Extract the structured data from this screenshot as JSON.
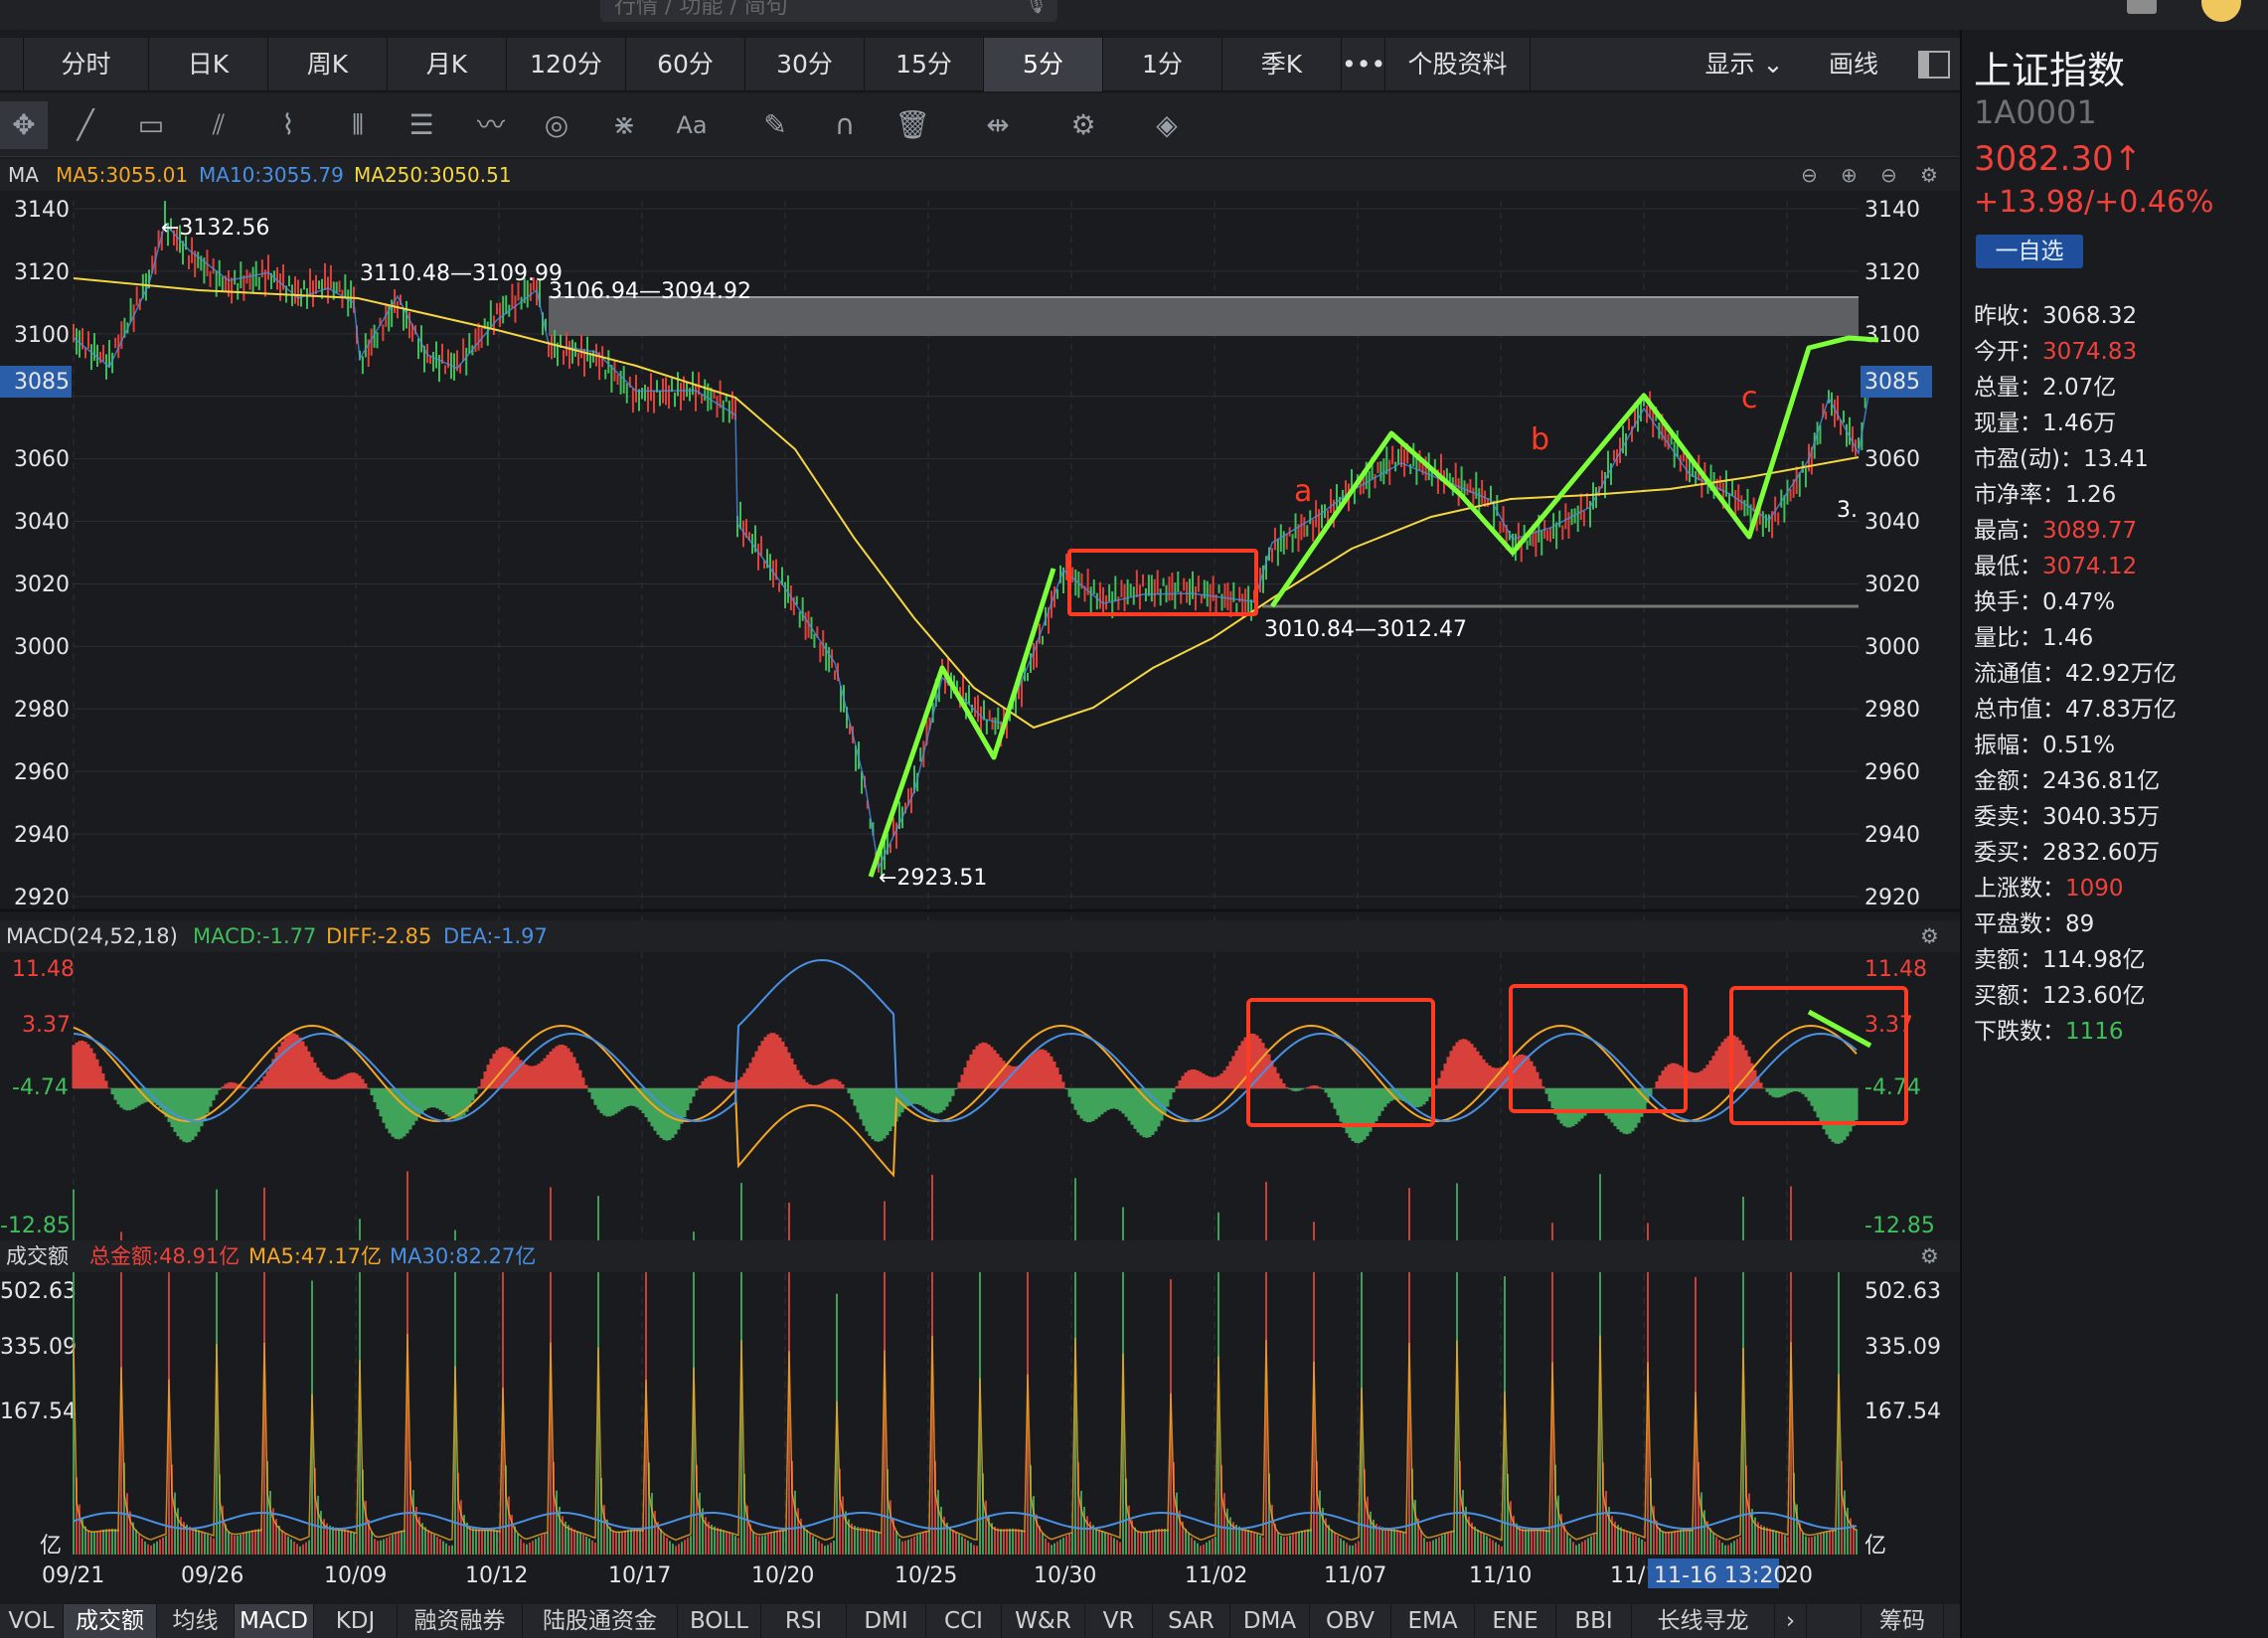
{
  "search": {
    "placeholder": "行情 / 功能 / 简句"
  },
  "periods": [
    "分时",
    "日K",
    "周K",
    "月K",
    "120分",
    "60分",
    "30分",
    "15分",
    "5分",
    "1分",
    "季K",
    "•••",
    "个股资料"
  ],
  "period_active": "5分",
  "header_right": {
    "display": "显示",
    "draw": "画线"
  },
  "ma_header": {
    "label": "MA",
    "ma5": "MA5:3055.01",
    "ma10": "MA10:3055.79",
    "ma250": "MA250:3050.51"
  },
  "price_axis": [
    "3140",
    "3120",
    "3100",
    "3085",
    "3060",
    "3040",
    "3020",
    "3000",
    "2980",
    "2960",
    "2940",
    "2920"
  ],
  "price_annotations": {
    "high": "←3132.56",
    "gap1": "3110.48—3109.99",
    "gap2": "3106.94—3094.92",
    "low": "←2923.51",
    "gap3": "3010.84—3012.47",
    "wave_a": "a",
    "wave_b": "b",
    "wave_c": "c",
    "right_cut": "3."
  },
  "macd_header": {
    "label": "MACD(24,52,18)",
    "macd": "MACD:-1.77",
    "diff": "DIFF:-2.85",
    "dea": "DEA:-1.97"
  },
  "macd_axis": [
    "11.48",
    "3.37",
    "-4.74",
    "-12.85"
  ],
  "vol_header": {
    "label": "成交额",
    "total": "总金额:48.91亿",
    "ma5": "MA5:47.17亿",
    "ma30": "MA30:82.27亿"
  },
  "vol_axis": [
    "502.63",
    "335.09",
    "167.54",
    "亿"
  ],
  "dates": [
    "09/21",
    "09/26",
    "10/09",
    "10/12",
    "10/17",
    "10/20",
    "10/25",
    "10/30",
    "11/02",
    "11/07",
    "11/10",
    "11/1",
    "11-16 13:20",
    "20"
  ],
  "bottom_tabs": [
    "VOL",
    "成交额",
    "均线",
    "MACD",
    "KDJ",
    "融资融券",
    "陆股通资金",
    "BOLL",
    "RSI",
    "DMI",
    "CCI",
    "W&R",
    "VR",
    "SAR",
    "DMA",
    "OBV",
    "EMA",
    "ENE",
    "BBI",
    "长线寻龙",
    "›"
  ],
  "bottom_active": [
    "成交额",
    "MACD"
  ],
  "chips_tab": "筹码",
  "stock": {
    "name": "上证指数",
    "code": "1A0001",
    "price": "3082.30↑",
    "change": "+13.98/+0.46%",
    "watch_button": "一自选"
  },
  "stats": [
    {
      "label": "昨收：",
      "value": "3068.32",
      "color": "#e8e8e8"
    },
    {
      "label": "今开：",
      "value": "3074.83",
      "color": "#f0413b"
    },
    {
      "label": "总量：",
      "value": "2.07亿",
      "color": "#e8e8e8"
    },
    {
      "label": "现量：",
      "value": "1.46万",
      "color": "#e8e8e8"
    },
    {
      "label": "市盈(动)：",
      "value": "13.41",
      "color": "#e8e8e8"
    },
    {
      "label": "市净率：",
      "value": "1.26",
      "color": "#e8e8e8"
    },
    {
      "label": "最高：",
      "value": "3089.77",
      "color": "#f0413b"
    },
    {
      "label": "最低：",
      "value": "3074.12",
      "color": "#f0413b"
    },
    {
      "label": "换手：",
      "value": "0.47%",
      "color": "#e8e8e8"
    },
    {
      "label": "量比：",
      "value": "1.46",
      "color": "#e8e8e8"
    },
    {
      "label": "流通值：",
      "value": "42.92万亿",
      "color": "#e8e8e8"
    },
    {
      "label": "总市值：",
      "value": "47.83万亿",
      "color": "#e8e8e8"
    },
    {
      "label": "振幅：",
      "value": "0.51%",
      "color": "#e8e8e8"
    },
    {
      "label": "金额：",
      "value": "2436.81亿",
      "color": "#e8e8e8"
    },
    {
      "label": "委卖：",
      "value": "3040.35万",
      "color": "#e8e8e8"
    },
    {
      "label": "委买：",
      "value": "2832.60万",
      "color": "#e8e8e8"
    },
    {
      "label": "上涨数：",
      "value": "1090",
      "color": "#f0413b"
    },
    {
      "label": "平盘数：",
      "value": "89",
      "color": "#e8e8e8"
    },
    {
      "label": "卖额：",
      "value": "114.98亿",
      "color": "#e8e8e8"
    },
    {
      "label": "买额：",
      "value": "123.60亿",
      "color": "#e8e8e8"
    },
    {
      "label": "下跌数：",
      "value": "1116",
      "color": "#3fbf5a"
    }
  ],
  "colors": {
    "up": "#f0413b",
    "down": "#3fbf5a",
    "ma5": "#f5a623",
    "ma10": "#4a90e2",
    "ma250": "#f5d742",
    "annot": "#7dff3a",
    "box": "#ff3b24"
  }
}
